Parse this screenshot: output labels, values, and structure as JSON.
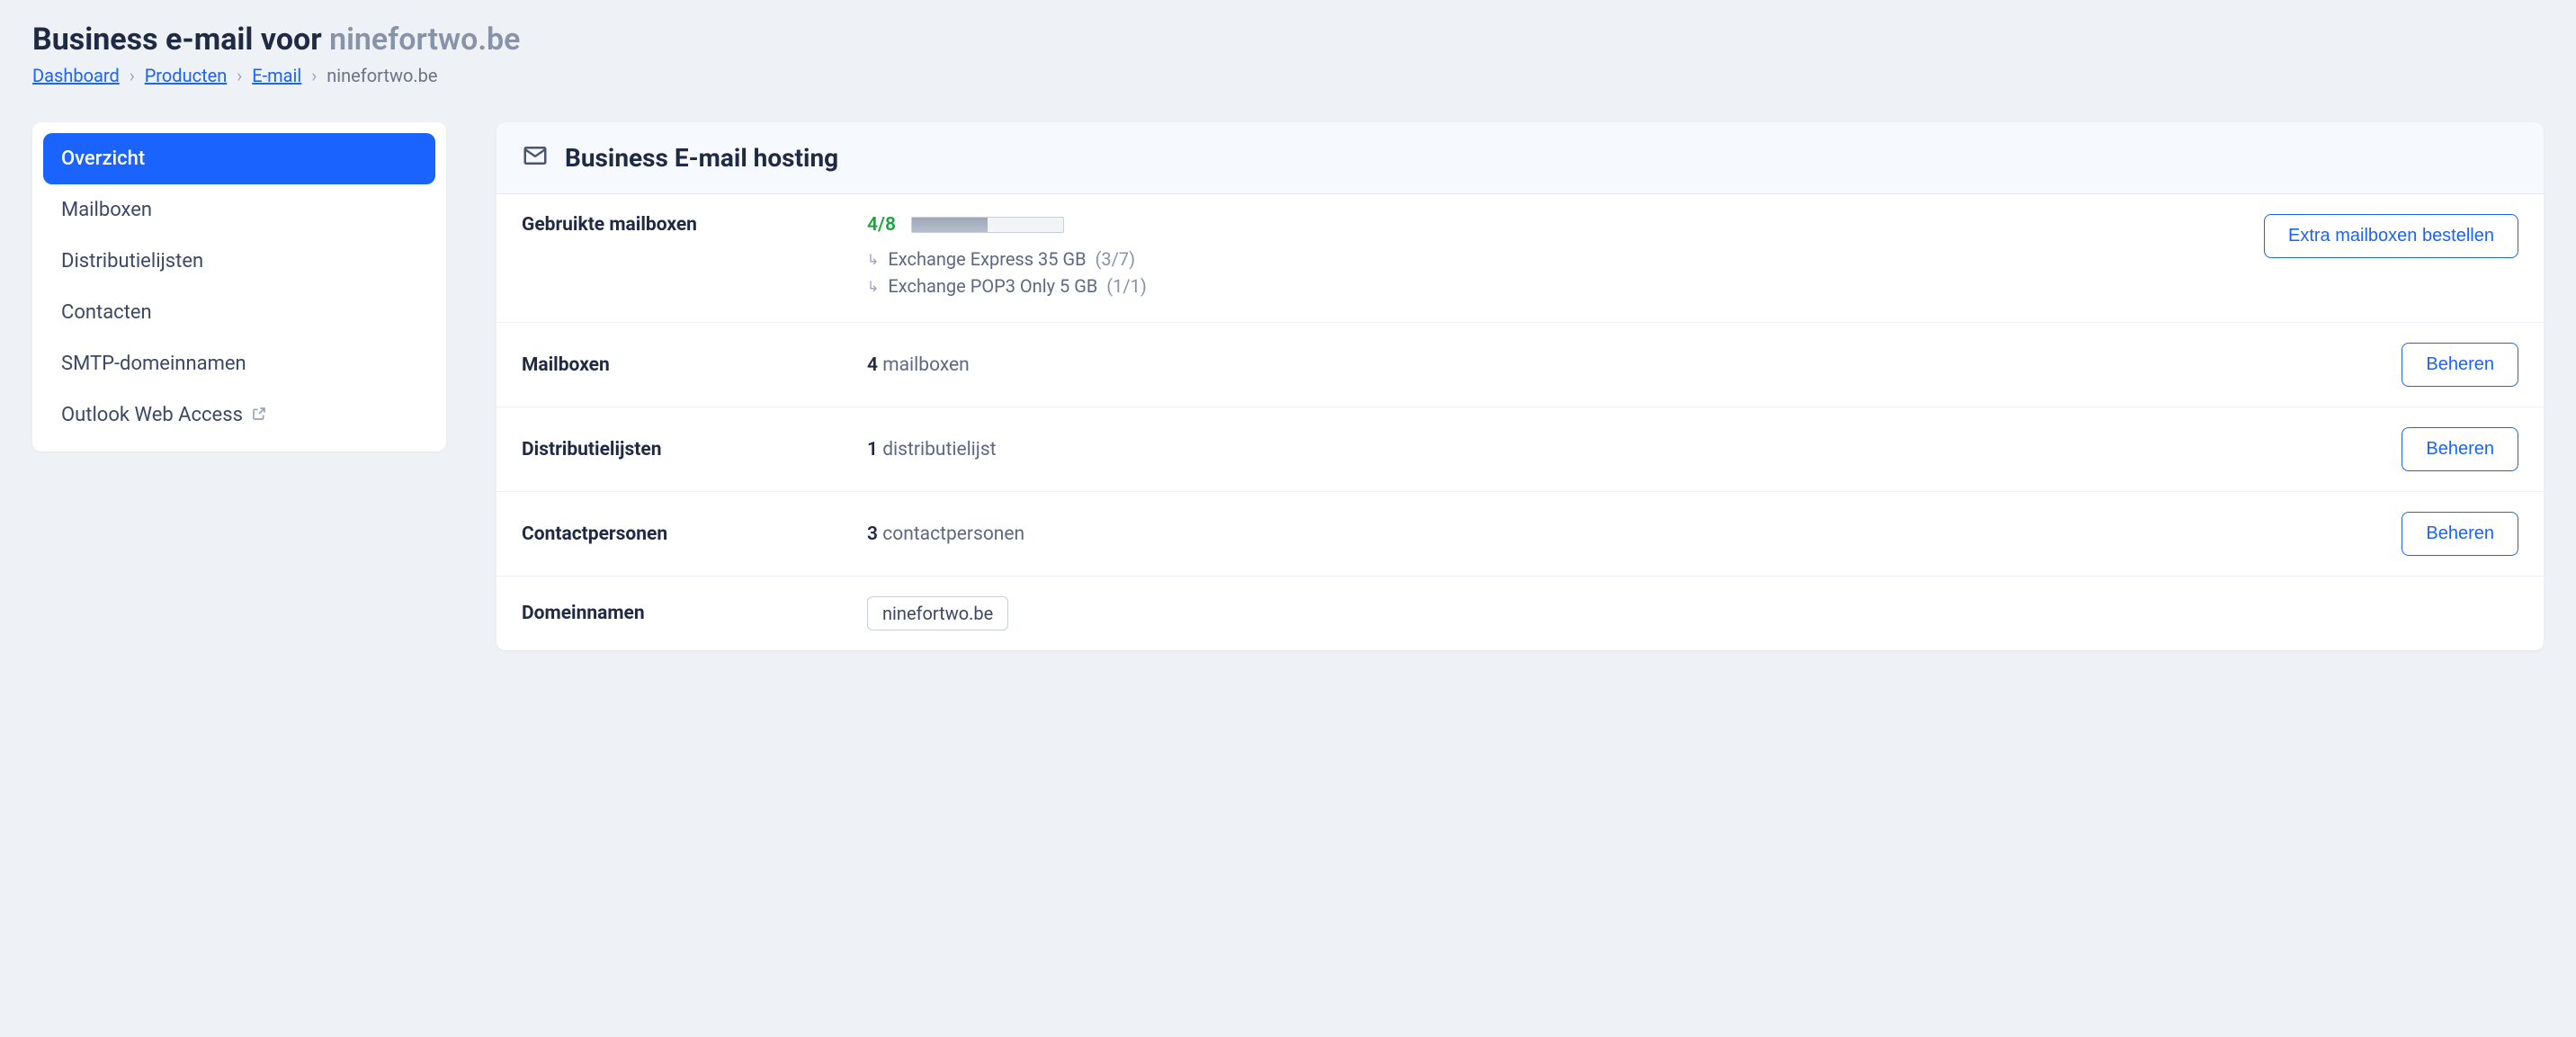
{
  "header": {
    "title_prefix": "Business e-mail voor ",
    "title_domain": "ninefortwo.be"
  },
  "breadcrumb": {
    "items": [
      {
        "label": "Dashboard",
        "link": true
      },
      {
        "label": "Producten",
        "link": true
      },
      {
        "label": "E-mail",
        "link": true
      },
      {
        "label": "ninefortwo.be",
        "link": false
      }
    ]
  },
  "sidebar": {
    "items": [
      {
        "label": "Overzicht",
        "active": true,
        "external": false
      },
      {
        "label": "Mailboxen",
        "active": false,
        "external": false
      },
      {
        "label": "Distributielijsten",
        "active": false,
        "external": false
      },
      {
        "label": "Contacten",
        "active": false,
        "external": false
      },
      {
        "label": "SMTP-domeinnamen",
        "active": false,
        "external": false
      },
      {
        "label": "Outlook Web Access",
        "active": false,
        "external": true
      }
    ]
  },
  "panel": {
    "title": "Business E-mail hosting",
    "usage": {
      "label": "Gebruikte mailboxen",
      "fraction": "4/8",
      "progress_percent": 50,
      "order_button": "Extra mailboxen bestellen",
      "breakdown": [
        {
          "name": "Exchange Express 35 GB",
          "count": "(3/7)"
        },
        {
          "name": "Exchange POP3 Only 5 GB",
          "count": "(1/1)"
        }
      ]
    },
    "rows": [
      {
        "label": "Mailboxen",
        "count": "4",
        "unit": "mailboxen",
        "action": "Beheren"
      },
      {
        "label": "Distributielijsten",
        "count": "1",
        "unit": "distributielijst",
        "action": "Beheren"
      },
      {
        "label": "Contactpersonen",
        "count": "3",
        "unit": "contactpersonen",
        "action": "Beheren"
      }
    ],
    "domains": {
      "label": "Domeinnamen",
      "tags": [
        "ninefortwo.be"
      ]
    }
  }
}
